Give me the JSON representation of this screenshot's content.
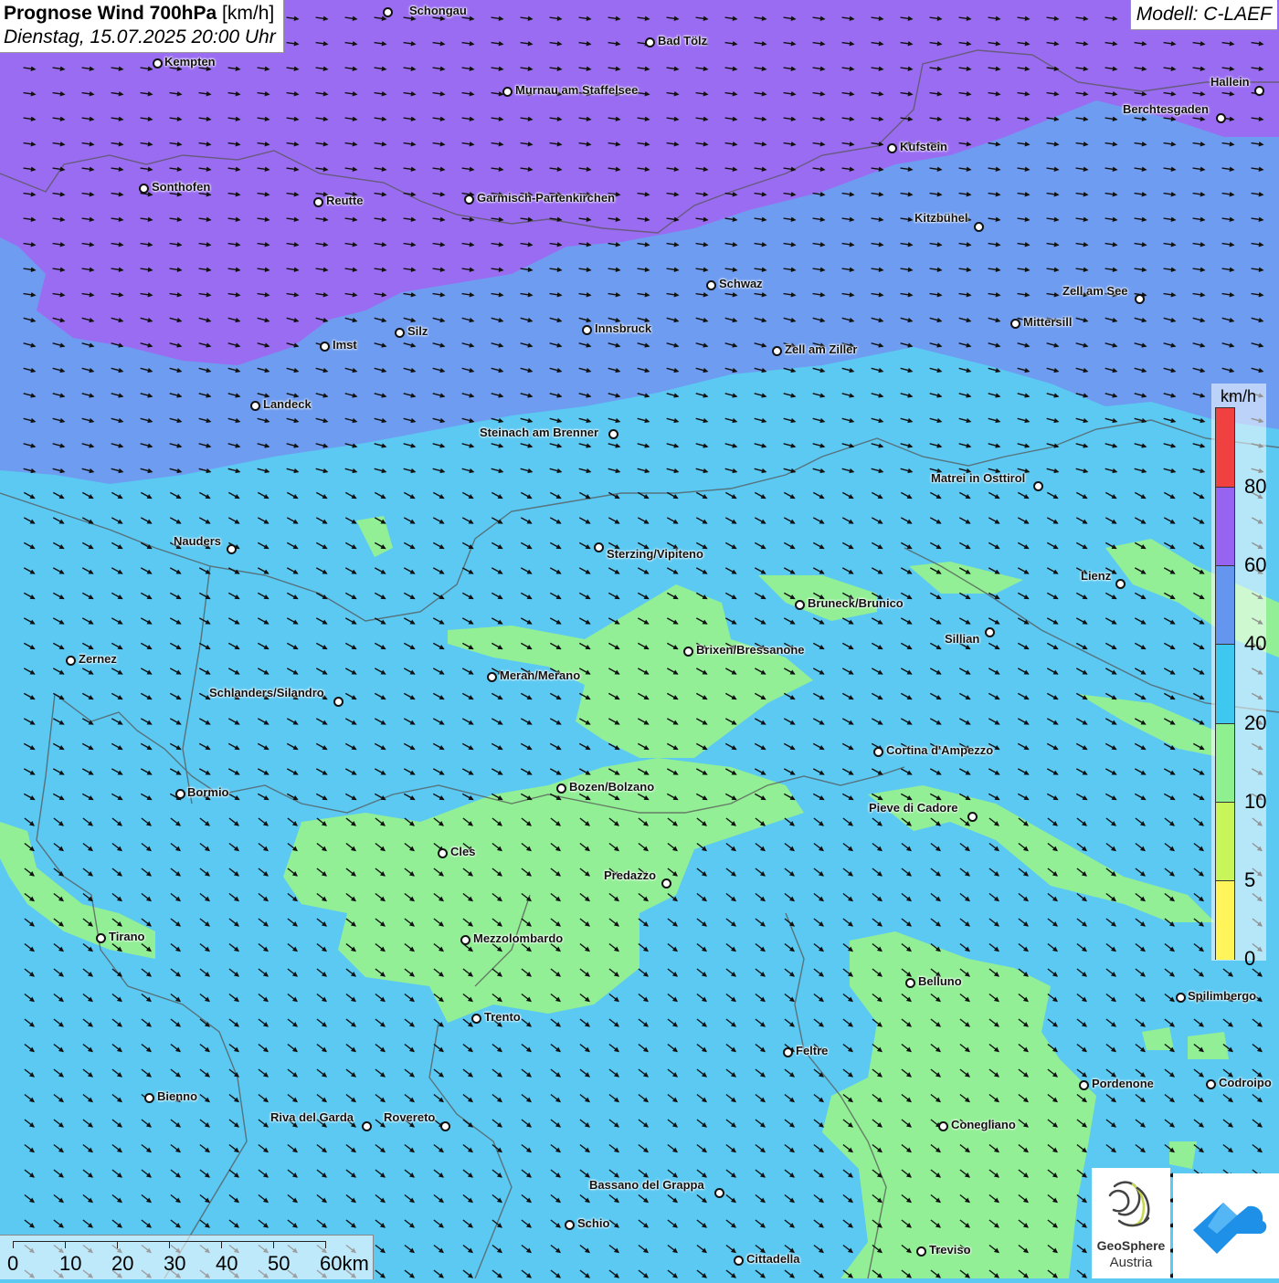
{
  "header": {
    "title_bold": "Prognose Wind 700hPa",
    "title_unit": "[km/h]",
    "date_line": "Dienstag, 15.07.2025 20:00 Uhr",
    "model": "Modell: C-LAEF"
  },
  "legend": {
    "unit": "km/h",
    "ticks": [
      "0",
      "5",
      "10",
      "20",
      "40",
      "60",
      "80"
    ],
    "colors": [
      "#fff55a",
      "#c8f55a",
      "#8ef08e",
      "#3ec8f0",
      "#6496f0",
      "#9664f0",
      "#f04040"
    ]
  },
  "scale_bar": {
    "labels": [
      "0",
      "10",
      "20",
      "30",
      "40",
      "50",
      "60km"
    ]
  },
  "logos": {
    "geosphere_line1": "GeoSphere",
    "geosphere_line2": "Austria"
  },
  "colors": {
    "zone_20_40": "#5bc9f2",
    "zone_40_60": "#6e9cf0",
    "zone_60_80": "#9a6cf2",
    "zone_10_20": "#92ef95",
    "arrow": "#111111"
  },
  "cities": [
    {
      "name": "Schongau"
    },
    {
      "name": "Bad Tölz"
    },
    {
      "name": "Kempten"
    },
    {
      "name": "Murnau am Staffelsee"
    },
    {
      "name": "Hallein"
    },
    {
      "name": "Berchtesgaden"
    },
    {
      "name": "Kufstein"
    },
    {
      "name": "Sonthofen"
    },
    {
      "name": "Reutte"
    },
    {
      "name": "Garmisch-Partenkirchen"
    },
    {
      "name": "Kitzbühel"
    },
    {
      "name": "Schwaz"
    },
    {
      "name": "Zell am See"
    },
    {
      "name": "Mittersill"
    },
    {
      "name": "Innsbruck"
    },
    {
      "name": "Silz"
    },
    {
      "name": "Imst"
    },
    {
      "name": "Zell am Ziller"
    },
    {
      "name": "Landeck"
    },
    {
      "name": "Steinach am Brenner"
    },
    {
      "name": "Matrei in Osttirol"
    },
    {
      "name": "Nauders"
    },
    {
      "name": "Sterzing/Vipiteno"
    },
    {
      "name": "Lienz"
    },
    {
      "name": "Bruneck/Brunico"
    },
    {
      "name": "Sillian"
    },
    {
      "name": "Brixen/Bressanone"
    },
    {
      "name": "Zernez"
    },
    {
      "name": "Meran/Merano"
    },
    {
      "name": "Schlanders/Silandro"
    },
    {
      "name": "Cortina d'Ampezzo"
    },
    {
      "name": "Bozen/Bolzano"
    },
    {
      "name": "Bormio"
    },
    {
      "name": "Pieve di Cadore"
    },
    {
      "name": "Cles"
    },
    {
      "name": "Predazzo"
    },
    {
      "name": "Tirano"
    },
    {
      "name": "Mezzolombardo"
    },
    {
      "name": "Belluno"
    },
    {
      "name": "Spilimbergo"
    },
    {
      "name": "Trento"
    },
    {
      "name": "Feltre"
    },
    {
      "name": "Pordenone"
    },
    {
      "name": "Codroipo"
    },
    {
      "name": "Bienno"
    },
    {
      "name": "Riva del Garda"
    },
    {
      "name": "Rovereto"
    },
    {
      "name": "Conegliano"
    },
    {
      "name": "Bassano del Grappa"
    },
    {
      "name": "Schio"
    },
    {
      "name": "Treviso"
    },
    {
      "name": "Cittadella"
    }
  ]
}
